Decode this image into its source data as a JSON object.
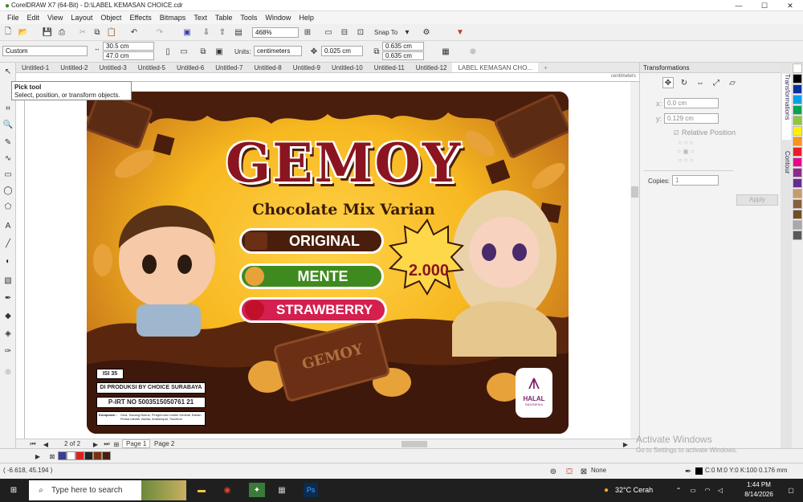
{
  "window": {
    "title": "CorelDRAW X7 (64-Bit) - D:\\LABEL KEMASAN CHOICE.cdr",
    "minimize": "—",
    "maximize": "☐",
    "close": "✕"
  },
  "menu": [
    "File",
    "Edit",
    "View",
    "Layout",
    "Object",
    "Effects",
    "Bitmaps",
    "Text",
    "Table",
    "Tools",
    "Window",
    "Help"
  ],
  "toolbar": {
    "zoom": "468%",
    "snap_to": "Snap To"
  },
  "property_bar": {
    "preset": "Custom",
    "width": "30.5 cm",
    "height": "47.0 cm",
    "units_label": "Units:",
    "units": "centimeters",
    "nudge": "0.025 cm",
    "dup_x": "0.635 cm",
    "dup_y": "0.635 cm"
  },
  "doc_tabs": [
    "Untitled-1",
    "Untitled-2",
    "Untitled-3",
    "Untitled-5",
    "Untitled-6",
    "Untitled-7",
    "Untitled-8",
    "Untitled-9",
    "Untitled-10",
    "Untitled-11",
    "Untitled-12",
    "LABEL KEMASAN CHO..."
  ],
  "ruler_units": "centimeters",
  "tooltip": {
    "title": "Pick tool",
    "text": "Select, position, or transform objects."
  },
  "label": {
    "brand": "GEMOY",
    "subtitle": "Chocolate Mix Varian",
    "variants": [
      {
        "name": "ORIGINAL",
        "color": "#4a1e0c"
      },
      {
        "name": "MENTE",
        "color": "#3f8a1f"
      },
      {
        "name": "STRAWBERRY",
        "color": "#d41f4f"
      }
    ],
    "price": "2.000",
    "bar_text": "GEMOY",
    "content": "ISI 35",
    "producer": "DI PRODUKSI BY CHOICE SURABAYA",
    "pirt": "P-IRT NO 5003515050761 21",
    "composition_label": "Komposisi :",
    "composition": "Gula, Kacang Bubuk, Pengemulsi Lesitin Kedelai, Bahan Perisa Identik Vanilla, Antikempal, Toscferol",
    "halal": "HALAL",
    "halal_sub": "INDONESIA"
  },
  "pages": {
    "current": "2 of 2",
    "tabs": [
      "Page 1",
      "Page 2"
    ]
  },
  "docker": {
    "title": "Transformations",
    "x": "0.0 cm",
    "y": "0.129 cm",
    "relative_position": "Relative Position",
    "copies_label": "Copies:",
    "copies": "1",
    "apply": "Apply",
    "vtabs": [
      "Transformations",
      "Contour"
    ]
  },
  "status": {
    "coords": "( -6.618, 45.194 )",
    "fill": "None",
    "outline": "C:0 M:0 Y:0 K:100  0.176 mm"
  },
  "watermark": {
    "line1": "Activate Windows",
    "line2": "Go to Settings to activate Windows."
  },
  "taskbar": {
    "search": "Type here to search",
    "weather": "32°C  Cerah",
    "time": "1:44 PM",
    "date": "8/14/2026"
  },
  "palette": [
    "#ffffff",
    "#000000",
    "#0033a0",
    "#00a2e8",
    "#00a651",
    "#8dc63f",
    "#fff200",
    "#f7941d",
    "#ed1c24",
    "#ec008c",
    "#92278f",
    "#662d91",
    "#c69c6d",
    "#8b5e3c",
    "#754c24",
    "#a7a9ac",
    "#58595b"
  ]
}
